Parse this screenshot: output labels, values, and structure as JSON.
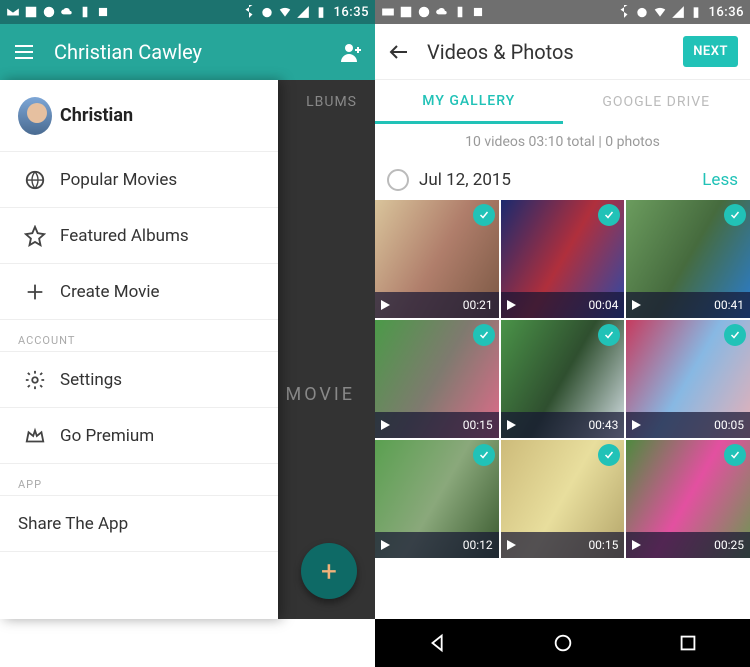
{
  "left": {
    "status_time": "16:35",
    "appbar_title": "Christian Cawley",
    "under_tab": "LBUMS",
    "under_text": "MOVIE",
    "drawer": {
      "user_name": "Christian",
      "items": [
        {
          "label": "Popular Movies",
          "icon": "globe-icon"
        },
        {
          "label": "Featured Albums",
          "icon": "star-icon"
        },
        {
          "label": "Create Movie",
          "icon": "plus-icon"
        }
      ],
      "section_account": "ACCOUNT",
      "account_items": [
        {
          "label": "Settings",
          "icon": "gear-icon"
        },
        {
          "label": "Go Premium",
          "icon": "crown-icon"
        }
      ],
      "section_app": "APP",
      "app_items": [
        {
          "label": "Share The App"
        }
      ]
    }
  },
  "right": {
    "status_time": "16:36",
    "appbar_title": "Videos & Photos",
    "next_label": "NEXT",
    "tabs": {
      "gallery": "MY GALLERY",
      "drive": "GOOGLE DRIVE"
    },
    "summary": "10 videos 03:10 total | 0 photos",
    "date": "Jul 12, 2015",
    "less": "Less",
    "thumbs": [
      {
        "dur": "00:21",
        "bg": "bg1"
      },
      {
        "dur": "00:04",
        "bg": "bg2"
      },
      {
        "dur": "00:41",
        "bg": "bg3"
      },
      {
        "dur": "00:15",
        "bg": "bg4"
      },
      {
        "dur": "00:43",
        "bg": "bg5"
      },
      {
        "dur": "00:05",
        "bg": "bg6"
      },
      {
        "dur": "00:12",
        "bg": "bg7"
      },
      {
        "dur": "00:15",
        "bg": "bg8"
      },
      {
        "dur": "00:25",
        "bg": "bg9"
      }
    ]
  }
}
